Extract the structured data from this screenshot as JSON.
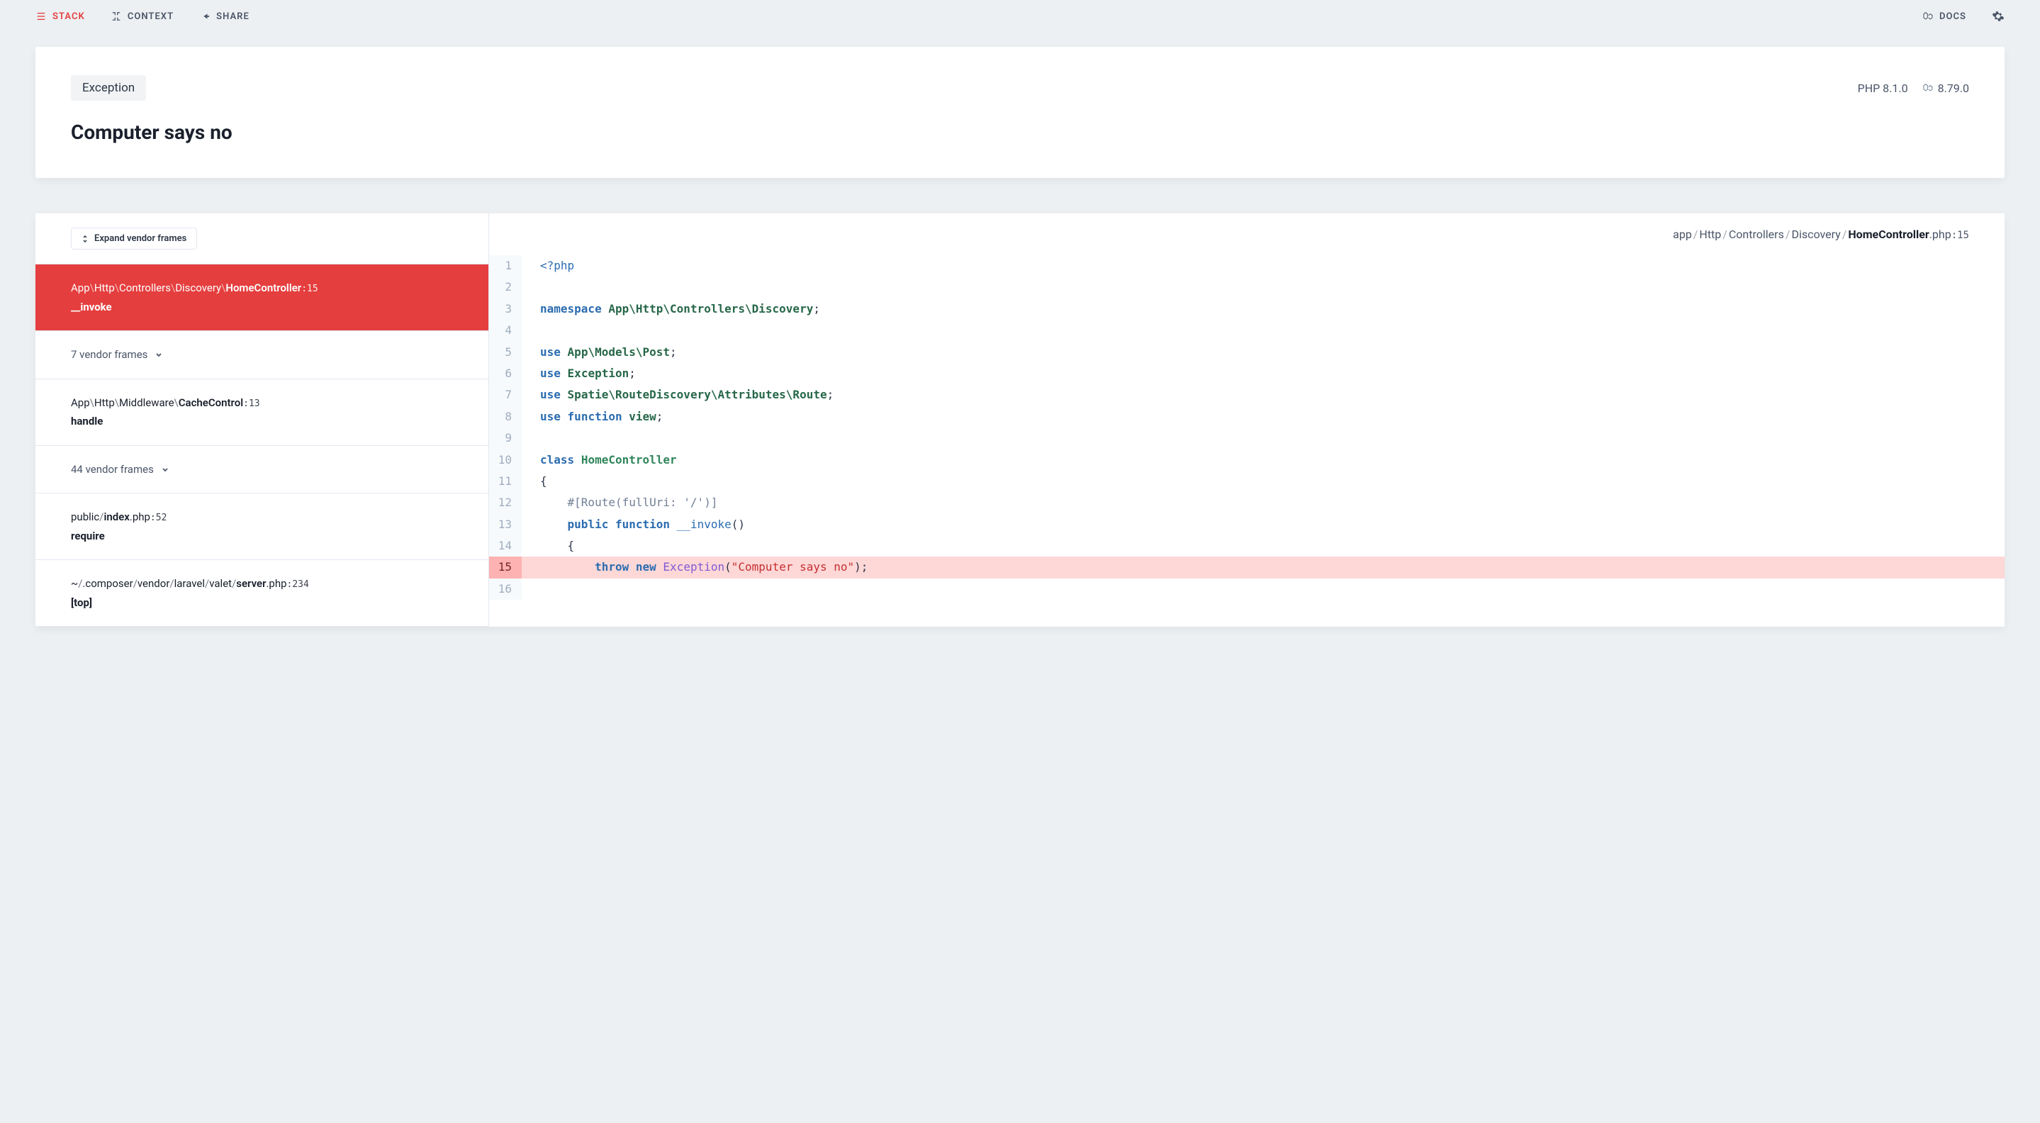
{
  "nav": {
    "stack": "STACK",
    "context": "CONTEXT",
    "share": "SHARE",
    "docs": "DOCS"
  },
  "header": {
    "exception_label": "Exception",
    "php_version": "PHP 8.1.0",
    "laravel_version": "8.79.0",
    "title": "Computer says no"
  },
  "sidebar": {
    "expand_label": "Expand vendor frames",
    "frames": [
      {
        "type": "frame",
        "active": true,
        "segments": [
          "App",
          "Http",
          "Controllers",
          "Discovery",
          "HomeController"
        ],
        "sep": "\\",
        "line": "15",
        "method": "__invoke"
      },
      {
        "type": "collapsed",
        "label": "7 vendor frames"
      },
      {
        "type": "frame",
        "segments": [
          "App",
          "Http",
          "Middleware",
          "CacheControl"
        ],
        "sep": "\\",
        "line": "13",
        "method": "handle"
      },
      {
        "type": "collapsed",
        "label": "44 vendor frames"
      },
      {
        "type": "frame",
        "segments": [
          "public",
          "index"
        ],
        "sep": "/",
        "ext": ".php",
        "line": "52",
        "method": "require"
      },
      {
        "type": "frame",
        "segments": [
          "~",
          ".composer",
          "vendor",
          "laravel",
          "valet",
          "server"
        ],
        "sep": "/",
        "ext": ".php",
        "line": "234",
        "method": "[top]"
      }
    ]
  },
  "code": {
    "breadcrumb": {
      "parts": [
        "app",
        "Http",
        "Controllers",
        "Discovery"
      ],
      "file": "HomeController",
      "ext": ".php",
      "line": "15"
    },
    "highlight_line": 15,
    "lines": [
      {
        "n": 1,
        "tokens": [
          [
            "tk-tag",
            "<?php"
          ]
        ]
      },
      {
        "n": 2,
        "tokens": []
      },
      {
        "n": 3,
        "tokens": [
          [
            "tk-kw",
            "namespace"
          ],
          [
            "",
            " "
          ],
          [
            "tk-ns",
            "App\\Http\\Controllers\\Discovery"
          ],
          [
            "tk-punc",
            ";"
          ]
        ]
      },
      {
        "n": 4,
        "tokens": []
      },
      {
        "n": 5,
        "tokens": [
          [
            "tk-kw",
            "use"
          ],
          [
            "",
            " "
          ],
          [
            "tk-ns",
            "App\\Models\\Post"
          ],
          [
            "tk-punc",
            ";"
          ]
        ]
      },
      {
        "n": 6,
        "tokens": [
          [
            "tk-kw",
            "use"
          ],
          [
            "",
            " "
          ],
          [
            "tk-ns",
            "Exception"
          ],
          [
            "tk-punc",
            ";"
          ]
        ]
      },
      {
        "n": 7,
        "tokens": [
          [
            "tk-kw",
            "use"
          ],
          [
            "",
            " "
          ],
          [
            "tk-ns",
            "Spatie\\RouteDiscovery\\Attributes\\Route"
          ],
          [
            "tk-punc",
            ";"
          ]
        ]
      },
      {
        "n": 8,
        "tokens": [
          [
            "tk-kw",
            "use"
          ],
          [
            "",
            " "
          ],
          [
            "tk-kw",
            "function"
          ],
          [
            "",
            " "
          ],
          [
            "tk-ns",
            "view"
          ],
          [
            "tk-punc",
            ";"
          ]
        ]
      },
      {
        "n": 9,
        "tokens": []
      },
      {
        "n": 10,
        "tokens": [
          [
            "tk-kw",
            "class"
          ],
          [
            "",
            " "
          ],
          [
            "tk-cls",
            "HomeController"
          ]
        ]
      },
      {
        "n": 11,
        "tokens": [
          [
            "tk-punc",
            "{"
          ]
        ]
      },
      {
        "n": 12,
        "tokens": [
          [
            "",
            "    "
          ],
          [
            "tk-com",
            "#[Route(fullUri: '/')]"
          ]
        ]
      },
      {
        "n": 13,
        "tokens": [
          [
            "",
            "    "
          ],
          [
            "tk-kw",
            "public"
          ],
          [
            "",
            " "
          ],
          [
            "tk-kw",
            "function"
          ],
          [
            "",
            " "
          ],
          [
            "tk-fn",
            "__invoke"
          ],
          [
            "tk-punc",
            "()"
          ]
        ]
      },
      {
        "n": 14,
        "tokens": [
          [
            "",
            "    "
          ],
          [
            "tk-punc",
            "{"
          ]
        ]
      },
      {
        "n": 15,
        "tokens": [
          [
            "",
            "        "
          ],
          [
            "tk-kw",
            "throw"
          ],
          [
            "",
            " "
          ],
          [
            "tk-kw",
            "new"
          ],
          [
            "",
            " "
          ],
          [
            "tk-exc",
            "Exception"
          ],
          [
            "tk-punc",
            "("
          ],
          [
            "tk-str",
            "\"Computer says no\""
          ],
          [
            "tk-punc",
            ");"
          ]
        ]
      },
      {
        "n": 16,
        "tokens": []
      }
    ]
  }
}
